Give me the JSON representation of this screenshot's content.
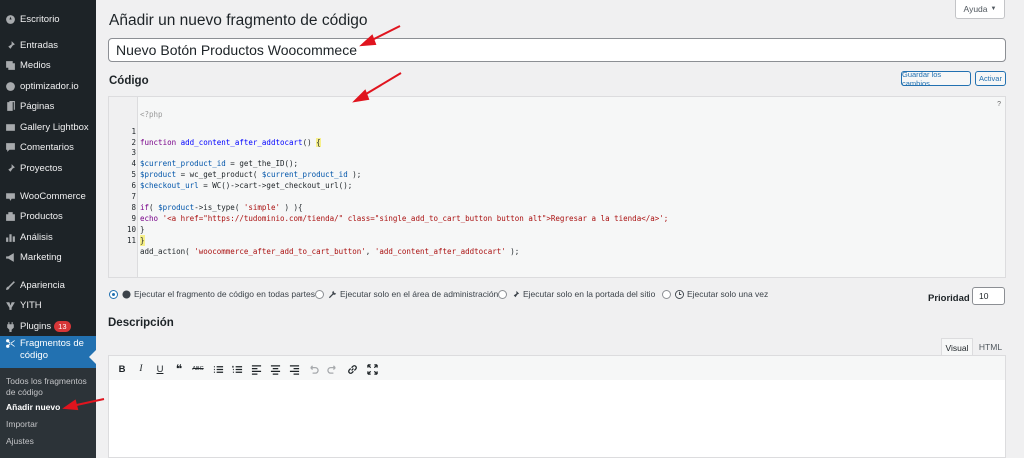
{
  "sidebar": {
    "items": [
      {
        "label": "Escritorio",
        "icon": "dashboard-icon"
      },
      {
        "label": "Entradas",
        "icon": "pin-icon"
      },
      {
        "label": "Medios",
        "icon": "media-icon"
      },
      {
        "label": "optimizador.io",
        "icon": "gauge-icon"
      },
      {
        "label": "Páginas",
        "icon": "pages-icon"
      },
      {
        "label": "Gallery Lightbox",
        "icon": "gallery-icon"
      },
      {
        "label": "Comentarios",
        "icon": "comment-icon"
      },
      {
        "label": "Proyectos",
        "icon": "pin-icon"
      },
      {
        "label": "WooCommerce",
        "icon": "woo-icon"
      },
      {
        "label": "Productos",
        "icon": "products-icon"
      },
      {
        "label": "Análisis",
        "icon": "chart-icon"
      },
      {
        "label": "Marketing",
        "icon": "megaphone-icon"
      },
      {
        "label": "Apariencia",
        "icon": "brush-icon"
      },
      {
        "label": "YITH",
        "icon": "yith-icon"
      },
      {
        "label": "Plugins",
        "icon": "plugin-icon",
        "badge": "13"
      },
      {
        "label": "Fragmentos de código",
        "icon": "scissors-icon"
      }
    ],
    "submenu": [
      "Todos los fragmentos de código",
      "Añadir nuevo",
      "Importar",
      "Ajustes"
    ]
  },
  "help_tab": "Ayuda",
  "page_title": "Añadir un nuevo fragmento de código",
  "snippet_title": "Nuevo Botón Productos Woocommece",
  "code": {
    "heading": "Código",
    "save_button": "Guardar los cambios",
    "activate_button": "Activar",
    "help_mark": "?",
    "line_numbers": [
      "1",
      "2",
      "3",
      "4",
      "5",
      "6",
      "7",
      "8",
      "9",
      "10",
      "11"
    ],
    "php_open": "<?php",
    "l1_kw": "function",
    "l1_fn": "add_content_after_addtocart",
    "l1_rest": "() ",
    "l1_brace": "{",
    "l3_var": "$current_product_id",
    "l3_rest": " = get_the_ID();",
    "l4_var": "$product",
    "l4_a": " = wc_get_product( ",
    "l4_var2": "$current_product_id",
    "l4_b": " );",
    "l5_var": "$checkout_url",
    "l5_rest": " = WC()->cart->get_checkout_url();",
    "l7_kw": "if",
    "l7_a": "( ",
    "l7_var": "$product",
    "l7_b": "->is_type( ",
    "l7_str": "'simple'",
    "l7_c": " ) ){",
    "l8_kw": "echo",
    "l8_str": " '<a href=\"https://tudominio.com/tienda/\" class=\"single_add_to_cart_button button alt\">Regresar a la tienda</a>';",
    "l9": "}",
    "l10": "}",
    "l11_a": "add_action( ",
    "l11_str1": "'woocommerce_after_add_to_cart_button'",
    "l11_b": ", ",
    "l11_str2": "'add_content_after_addtocart'",
    "l11_c": " );"
  },
  "scope": {
    "options": [
      "Ejecutar el fragmento de código en todas partes",
      "Ejecutar solo en el área de administración",
      "Ejecutar solo en la portada del sitio",
      "Ejecutar solo una vez"
    ],
    "selected": "Ejecutar el fragmento de código en todas partes"
  },
  "priority": {
    "label": "Prioridad",
    "value": "10"
  },
  "description": {
    "heading": "Descripción",
    "tab_visual": "Visual",
    "tab_html": "HTML",
    "toolbar": {
      "bold": "B",
      "italic": "I",
      "underline": "U",
      "quote": "❝",
      "strike": "ABC"
    }
  }
}
